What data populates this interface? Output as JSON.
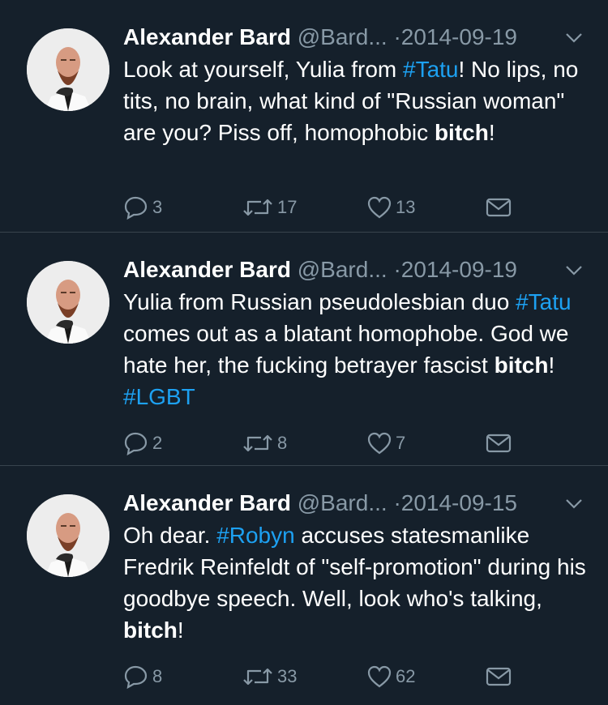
{
  "tweets": [
    {
      "name": "Alexander Bard",
      "handle": "@Bard...",
      "separator": "·",
      "date": "2014-09-19",
      "segments": [
        {
          "t": "Look at yourself, Yulia from "
        },
        {
          "t": "#Tatu",
          "kind": "hashtag"
        },
        {
          "t": "! No lips, no tits, no brain, what kind of \"Russian woman\" are you? Piss off, homophobic "
        },
        {
          "t": "bitch",
          "kind": "bold"
        },
        {
          "t": "!"
        }
      ],
      "replies": "3",
      "retweets": "17",
      "likes": "13"
    },
    {
      "name": "Alexander Bard",
      "handle": "@Bard...",
      "separator": "·",
      "date": "2014-09-19",
      "segments": [
        {
          "t": "Yulia from Russian pseudolesbian duo "
        },
        {
          "t": "#Tatu",
          "kind": "hashtag"
        },
        {
          "t": " comes out as a blatant homophobe. God we hate her, the fucking betrayer fascist "
        },
        {
          "t": "bitch",
          "kind": "bold"
        },
        {
          "t": "! "
        },
        {
          "t": "#LGBT",
          "kind": "hashtag"
        }
      ],
      "replies": "2",
      "retweets": "8",
      "likes": "7"
    },
    {
      "name": "Alexander Bard",
      "handle": "@Bard...",
      "separator": "·",
      "date": "2014-09-15",
      "segments": [
        {
          "t": "Oh dear. "
        },
        {
          "t": "#Robyn",
          "kind": "hashtag"
        },
        {
          "t": " accuses statesmanlike Fredrik Reinfeldt of \"self-promotion\" during his goodbye speech. Well, look who's talking, "
        },
        {
          "t": "bitch",
          "kind": "bold"
        },
        {
          "t": "!"
        }
      ],
      "replies": "8",
      "retweets": "33",
      "likes": "62"
    }
  ],
  "icons": {
    "reply": "reply-icon",
    "retweet": "retweet-icon",
    "like": "heart-icon",
    "message": "envelope-icon",
    "caret": "chevron-down-icon"
  },
  "colors": {
    "background": "#15202b",
    "divider": "#38444d",
    "text": "#ffffff",
    "muted": "#8899a6",
    "link": "#1da1f2"
  }
}
